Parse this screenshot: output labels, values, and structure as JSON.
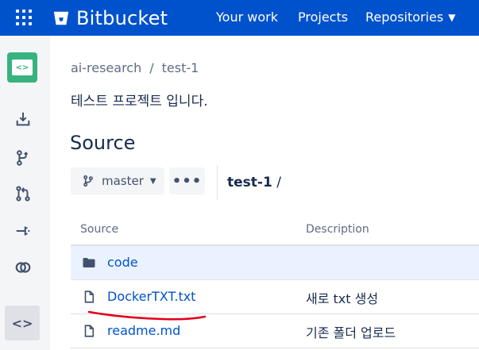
{
  "header": {
    "app_name": "Bitbucket",
    "nav": {
      "your_work": "Your work",
      "projects": "Projects",
      "repositories": "Repositories"
    },
    "colors": {
      "bar": "#0052CC"
    }
  },
  "sidebar": {
    "items": [
      "repo-avatar",
      "clone-icon",
      "commits-icon",
      "pull-requests-icon",
      "pipelines-icon",
      "branches-icon",
      "source-icon"
    ],
    "repo_avatar_glyph": "<>",
    "active_glyph": "<>"
  },
  "breadcrumb": {
    "project": "ai-research",
    "separator": "/",
    "repo": "test-1"
  },
  "repo_description": "테스트 프로젝트 입니다.",
  "page": {
    "title": "Source",
    "branch": "master",
    "more": "•••",
    "path_repo": "test-1",
    "path_sep": "/"
  },
  "table": {
    "headers": {
      "source": "Source",
      "description": "Description"
    },
    "rows": [
      {
        "type": "folder",
        "name": "code",
        "description": ""
      },
      {
        "type": "file",
        "name": "DockerTXT.txt",
        "description": "새로 txt 생성"
      },
      {
        "type": "file",
        "name": "readme.md",
        "description": "기존 폴더 업로드"
      }
    ]
  }
}
